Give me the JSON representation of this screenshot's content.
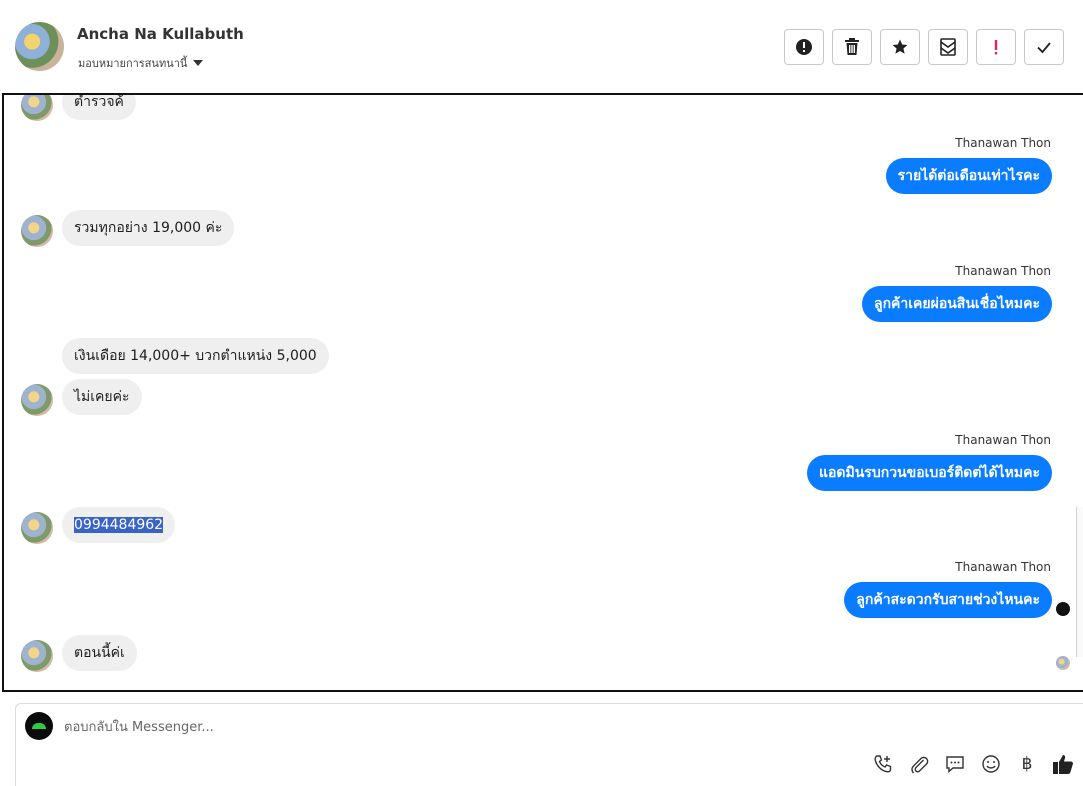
{
  "header": {
    "contact_name": "Ancha Na Kullabuth",
    "assign_label": "มอบหมายการสนทนานี้",
    "actions": [
      {
        "name": "report-button",
        "icon": "alert-circle-icon"
      },
      {
        "name": "delete-button",
        "icon": "trash-icon"
      },
      {
        "name": "star-button",
        "icon": "star-icon"
      },
      {
        "name": "mark-unread-button",
        "icon": "envelope-icon"
      },
      {
        "name": "spam-button",
        "icon": "exclamation-icon",
        "color": "#e0245e"
      },
      {
        "name": "done-button",
        "icon": "check-icon"
      }
    ]
  },
  "messages": [
    {
      "type": "in",
      "text": "ตำรวจค้"
    },
    {
      "type": "out",
      "sender": "Thanawan Thon",
      "text": "รายได้ต่อเดือนเท่าไรคะ"
    },
    {
      "type": "in",
      "text": "รวมทุกอย่าง 19,000 ค่ะ"
    },
    {
      "type": "out",
      "sender": "Thanawan Thon",
      "text": "ลูกค้าเคยผ่อนสินเชื่อไหมคะ"
    },
    {
      "type": "in",
      "text": "เงินเดือย 14,000+ บวกตำแหน่ง 5,000"
    },
    {
      "type": "in",
      "text": "ไม่เคยค่ะ"
    },
    {
      "type": "out",
      "sender": "Thanawan Thon",
      "text": "แอดมินรบกวนขอเบอร์ติดต่ได้ไหมคะ"
    },
    {
      "type": "in",
      "text": "0994484962"
    },
    {
      "type": "out",
      "sender": "Thanawan Thon",
      "text": "ลูกค้าสะดวกรับสายช่วงไหนคะ"
    },
    {
      "type": "in",
      "text": "ตอนนี้ค่เ"
    }
  ],
  "composer": {
    "placeholder": "ตอบกลับใน Messenger...",
    "tools": [
      "phone-plus-icon",
      "paperclip-icon",
      "chat-bubble-icon",
      "smiley-icon",
      "baht-icon",
      "thumbs-up-icon"
    ],
    "baht_symbol": "฿"
  },
  "colors": {
    "outgoing_bubble": "#0a7cff",
    "incoming_bubble": "#efefef",
    "selection": "#3a63c7"
  }
}
